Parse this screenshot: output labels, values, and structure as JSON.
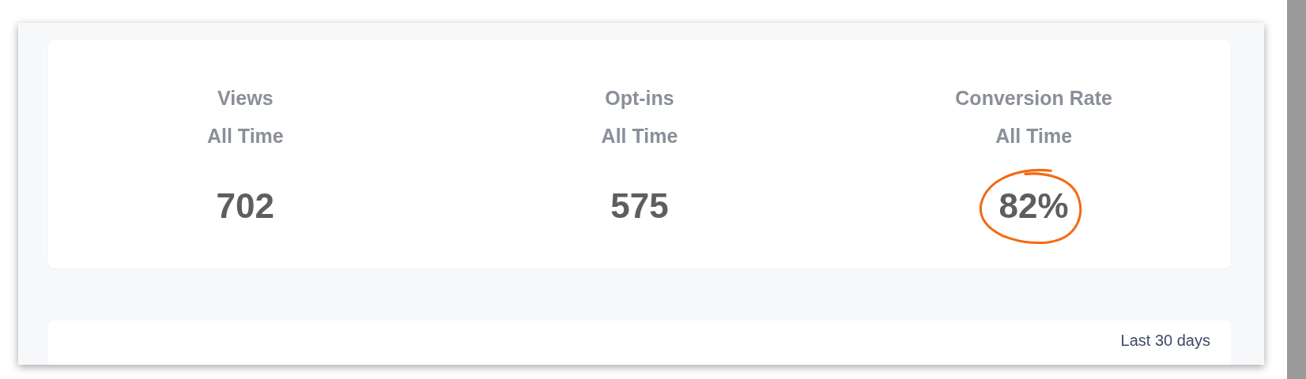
{
  "stats": [
    {
      "label": "Views",
      "period": "All Time",
      "value": "702",
      "highlighted": false
    },
    {
      "label": "Opt-ins",
      "period": "All Time",
      "value": "575",
      "highlighted": false
    },
    {
      "label": "Conversion Rate",
      "period": "All Time",
      "value": "82%",
      "highlighted": true
    }
  ],
  "range_label": "Last 30 days"
}
